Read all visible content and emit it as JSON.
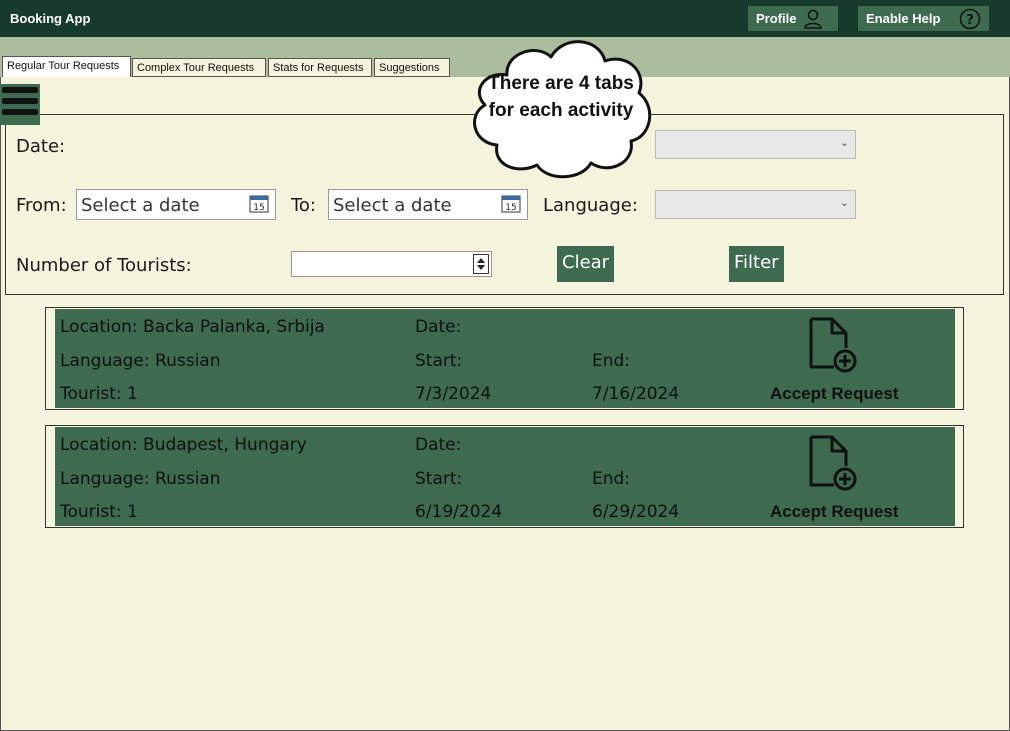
{
  "app": {
    "title": "Booking App",
    "profile_label": "Profile",
    "help_label": "Enable Help"
  },
  "tabs": [
    {
      "label": "Regular Tour Requests",
      "active": true
    },
    {
      "label": "Complex Tour Requests",
      "active": false
    },
    {
      "label": "Stats for Requests",
      "active": false
    },
    {
      "label": "Suggestions",
      "active": false
    }
  ],
  "callout": {
    "text": "There are 4 tabs for each activity"
  },
  "filters": {
    "date_label": "Date:",
    "from_label": "From:",
    "from_placeholder": "Select a date",
    "to_label": "To:",
    "to_placeholder": "Select a date",
    "language_label": "Language:",
    "tourists_label": "Number of Tourists:",
    "clear_label": "Clear",
    "filter_label": "Filter",
    "calendar_day": "15"
  },
  "requests": [
    {
      "location": "Location: Backa Palanka, Srbija",
      "language": "Language: Russian",
      "tourist": "Tourist: 1",
      "date_label": "Date:",
      "start_label": "Start:",
      "end_label": "End:",
      "start": "7/3/2024",
      "end": "7/16/2024",
      "accept_label": "Accept Request"
    },
    {
      "location": "Location: Budapest, Hungary",
      "language": "Language: Russian",
      "tourist": "Tourist: 1",
      "date_label": "Date:",
      "start_label": "Start:",
      "end_label": "End:",
      "start": "6/19/2024",
      "end": "6/29/2024",
      "accept_label": "Accept Request"
    }
  ],
  "colors": {
    "titlebar": "#163a2c",
    "accent": "#3e6a4f",
    "tabbar": "#abbd9c",
    "background": "#f4f4dd"
  },
  "icons": {
    "profile": "user-icon",
    "help": "question-circle-icon",
    "menu": "hamburger-icon",
    "calendar": "calendar-icon",
    "accept": "document-add-icon"
  }
}
